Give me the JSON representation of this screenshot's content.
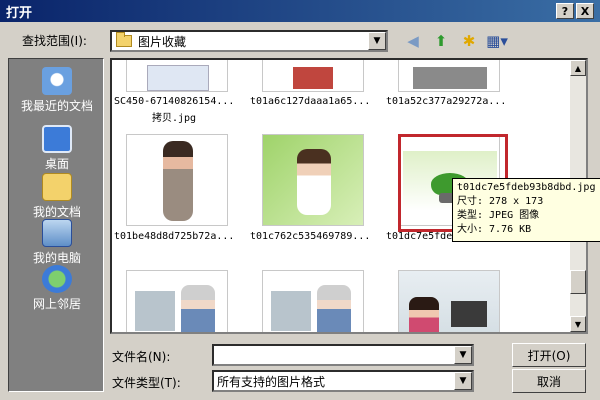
{
  "window": {
    "title": "打开",
    "help_label": "?",
    "close_label": "X"
  },
  "toolbar": {
    "look_in_label": "查找范围(I):",
    "look_in_value": "图片收藏"
  },
  "places": [
    {
      "label": "我最近的文档"
    },
    {
      "label": "桌面"
    },
    {
      "label": "我的文档"
    },
    {
      "label": "我的电脑"
    },
    {
      "label": "网上邻居"
    }
  ],
  "files": [
    {
      "name": "SC450-67140826154...",
      "name2": "拷贝.jpg"
    },
    {
      "name": "t01a6c127daaa1a65..."
    },
    {
      "name": "t01a52c377a29272a..."
    },
    {
      "name": "t01be48d8d725b72a..."
    },
    {
      "name": "t01c762c535469789..."
    },
    {
      "name": "t01dc7e5fdeb..."
    }
  ],
  "tooltip": {
    "line1": "t01dc7e5fdeb93b8dbd.jpg",
    "line2": "尺寸: 278 x 173",
    "line3": "类型: JPEG 图像",
    "line4": "大小: 7.76 KB"
  },
  "bottom": {
    "filename_label": "文件名(N):",
    "filename_value": "",
    "filetype_label": "文件类型(T):",
    "filetype_value": "所有支持的图片格式",
    "open_label": "打开(O)",
    "cancel_label": "取消"
  }
}
